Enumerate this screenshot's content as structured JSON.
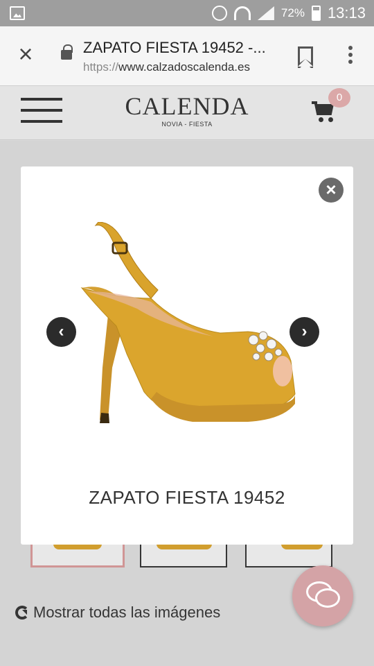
{
  "status_bar": {
    "battery": "72%",
    "time": "13:13"
  },
  "browser": {
    "page_title": "ZAPATO FIESTA 19452 -...",
    "url_protocol": "https://",
    "url_host": "www.calzadoscalenda.es"
  },
  "site": {
    "brand": "CALENDA",
    "tagline": "NOVIA - FIESTA",
    "cart_count": "0"
  },
  "lightbox": {
    "caption": "ZAPATO FIESTA 19452",
    "close_label": "×",
    "prev_label": "‹",
    "next_label": "›",
    "image_icon": "shoe-image"
  },
  "gallery": {
    "show_all_label": "Mostrar todas las imágenes",
    "thumbnail_count": 3
  },
  "colors": {
    "accent": "#d4a3a6",
    "shoe": "#d9a32c"
  }
}
